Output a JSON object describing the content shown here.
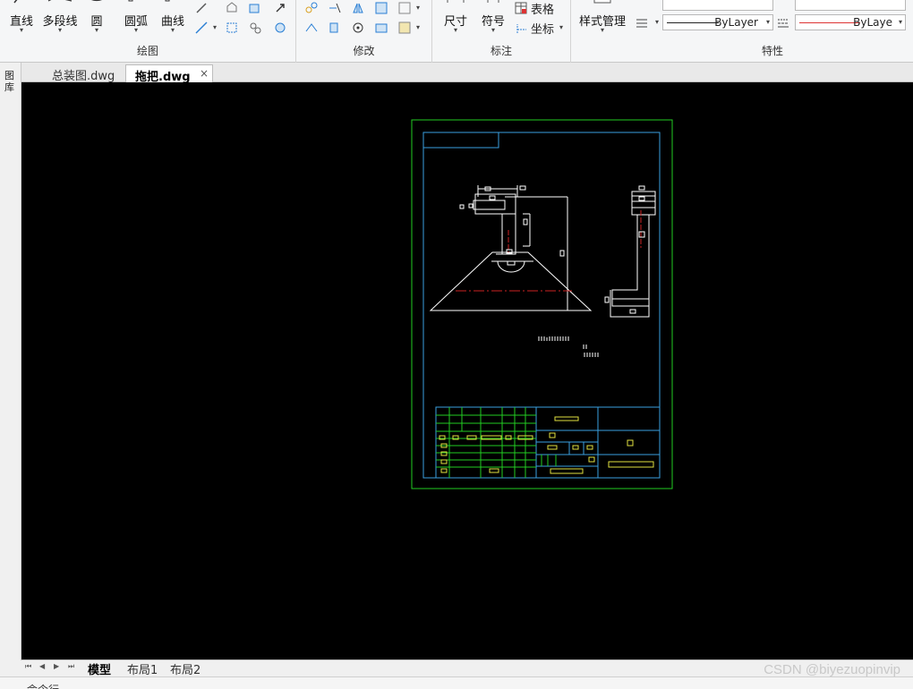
{
  "ribbon": {
    "draw_panel": {
      "title": "绘图",
      "buttons": [
        {
          "label": "直线",
          "icon": "line-icon"
        },
        {
          "label": "多段线",
          "icon": "polyline-icon"
        },
        {
          "label": "圆",
          "icon": "circle-icon"
        },
        {
          "label": "圆弧",
          "icon": "arc-icon"
        },
        {
          "label": "曲线",
          "icon": "curve-icon"
        }
      ]
    },
    "modify_panel": {
      "title": "修改"
    },
    "annotate_panel": {
      "title": "标注",
      "dimension_label": "尺寸",
      "symbol_label": "符号",
      "table_label": "表格",
      "coord_label": "坐标"
    },
    "style_panel": {
      "label": "样式管理"
    },
    "properties_panel": {
      "title": "特性",
      "linetype_value": "ByLayer",
      "color_value": "ByLaye"
    }
  },
  "tabs": [
    {
      "label": "总装图.dwg",
      "active": false
    },
    {
      "label": "拖把.dwg",
      "active": true,
      "close": "×"
    }
  ],
  "left_strip": {
    "label": "图库"
  },
  "layout_tabs": [
    {
      "label": "模型",
      "active": true
    },
    {
      "label": "布局1",
      "active": false
    },
    {
      "label": "布局2",
      "active": false
    }
  ],
  "nav_buttons": [
    "⏮",
    "◀",
    "▶",
    "⏭"
  ],
  "command_line": {
    "label": "命令行"
  },
  "watermark": "CSDN @biyezuopinvip",
  "colors": {
    "canvas_bg": "#000000",
    "border_green": "#22cc22",
    "frame_blue": "#3aa0e0",
    "title_block_yellow": "#e0e040",
    "geometry_white": "#ffffff",
    "centerline_red": "#cc2222",
    "table_green": "#22cc22"
  }
}
